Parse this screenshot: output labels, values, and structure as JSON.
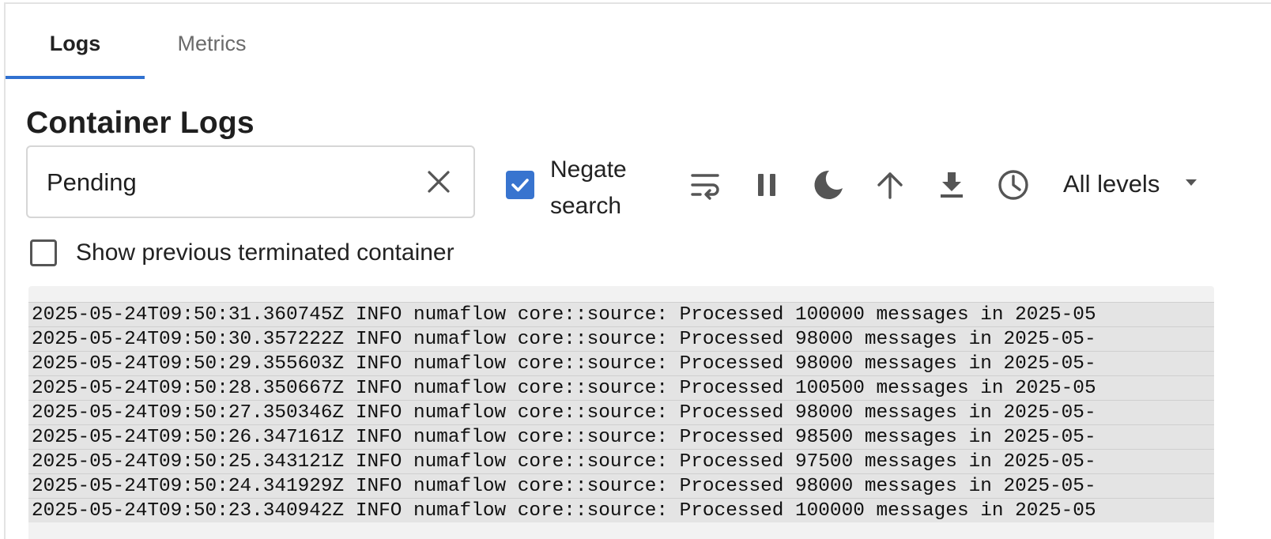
{
  "tabs": [
    {
      "label": "Logs",
      "active": true
    },
    {
      "label": "Metrics",
      "active": false
    }
  ],
  "accent_color": "#3071d0",
  "section_title": "Container Logs",
  "search": {
    "value": "Pending"
  },
  "negate": {
    "label": "Negate search",
    "checked": true
  },
  "toolbar_icons": [
    "wrap-lines-icon",
    "pause-icon",
    "dark-mode-icon",
    "scroll-to-top-icon",
    "download-icon",
    "time-icon"
  ],
  "level_filter": {
    "value": "All levels"
  },
  "show_previous": {
    "label": "Show previous terminated container",
    "checked": false
  },
  "logs": [
    "2025-05-24T09:50:31.360745Z INFO numaflow core::source: Processed 100000 messages in 2025-05",
    "2025-05-24T09:50:30.357222Z INFO numaflow core::source: Processed 98000 messages in 2025-05-",
    "2025-05-24T09:50:29.355603Z INFO numaflow core::source: Processed 98000 messages in 2025-05-",
    "2025-05-24T09:50:28.350667Z INFO numaflow core::source: Processed 100500 messages in 2025-05",
    "2025-05-24T09:50:27.350346Z INFO numaflow core::source: Processed 98000 messages in 2025-05-",
    "2025-05-24T09:50:26.347161Z INFO numaflow core::source: Processed 98500 messages in 2025-05-",
    "2025-05-24T09:50:25.343121Z INFO numaflow core::source: Processed 97500 messages in 2025-05-",
    "2025-05-24T09:50:24.341929Z INFO numaflow core::source: Processed 98000 messages in 2025-05-",
    "2025-05-24T09:50:23.340942Z INFO numaflow core::source: Processed 100000 messages in 2025-05"
  ]
}
